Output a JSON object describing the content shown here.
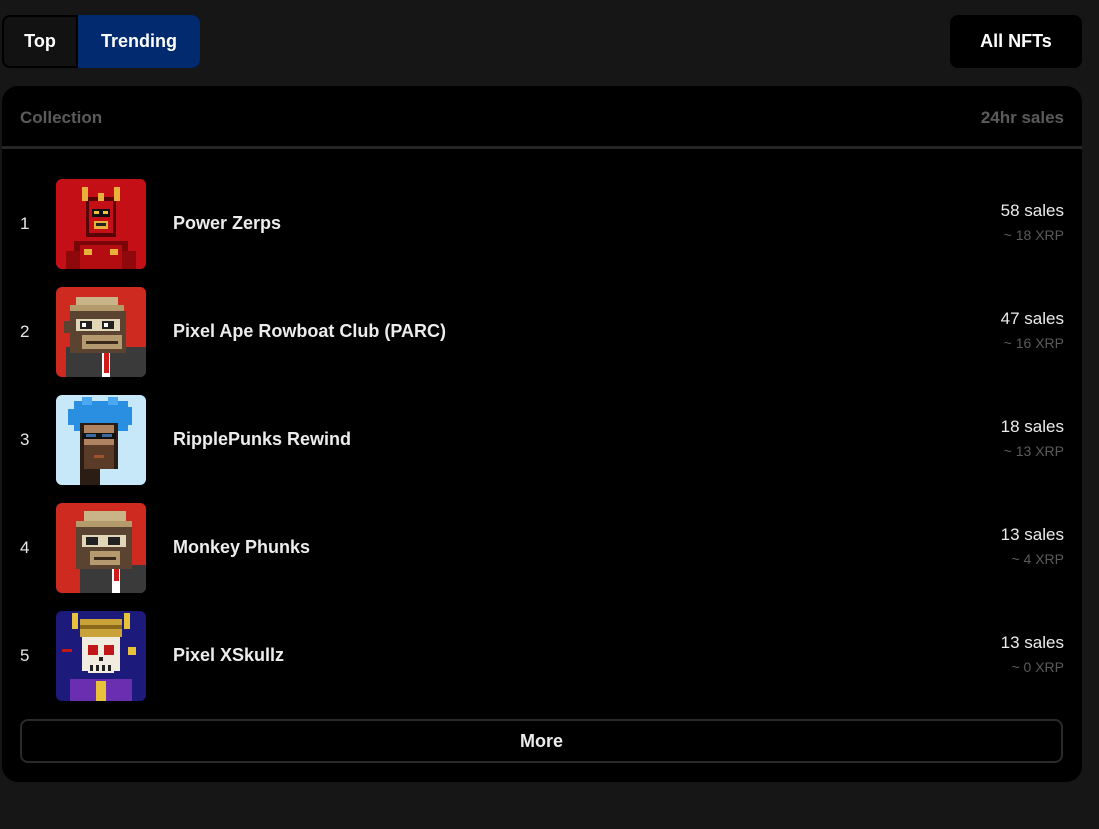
{
  "tabs": [
    {
      "label": "Top",
      "active": false
    },
    {
      "label": "Trending",
      "active": true
    }
  ],
  "all_nfts_label": "All NFTs",
  "table": {
    "col_collection": "Collection",
    "col_sales": "24hr sales",
    "rows": [
      {
        "rank": "1",
        "name": "Power Zerps",
        "sales": "58 sales",
        "xrp": "~ 18 XRP",
        "avatar": "red-armored-zerp-avatar"
      },
      {
        "rank": "2",
        "name": "Pixel Ape Rowboat Club (PARC)",
        "sales": "47 sales",
        "xrp": "~ 16 XRP",
        "avatar": "pixel-ape-avatar"
      },
      {
        "rank": "3",
        "name": "RipplePunks Rewind",
        "sales": "18 sales",
        "xrp": "~ 13 XRP",
        "avatar": "blue-hair-punk-avatar"
      },
      {
        "rank": "4",
        "name": "Monkey Phunks",
        "sales": "13 sales",
        "xrp": "~ 4 XRP",
        "avatar": "monkey-phunk-avatar"
      },
      {
        "rank": "5",
        "name": "Pixel XSkullz",
        "sales": "13 sales",
        "xrp": "~ 0 XRP",
        "avatar": "horned-skull-avatar"
      }
    ],
    "more_label": "More"
  },
  "colors": {
    "background": "#161616",
    "panel": "#000000",
    "active_tab": "#022a6e",
    "muted_text": "#5b5b5b"
  }
}
